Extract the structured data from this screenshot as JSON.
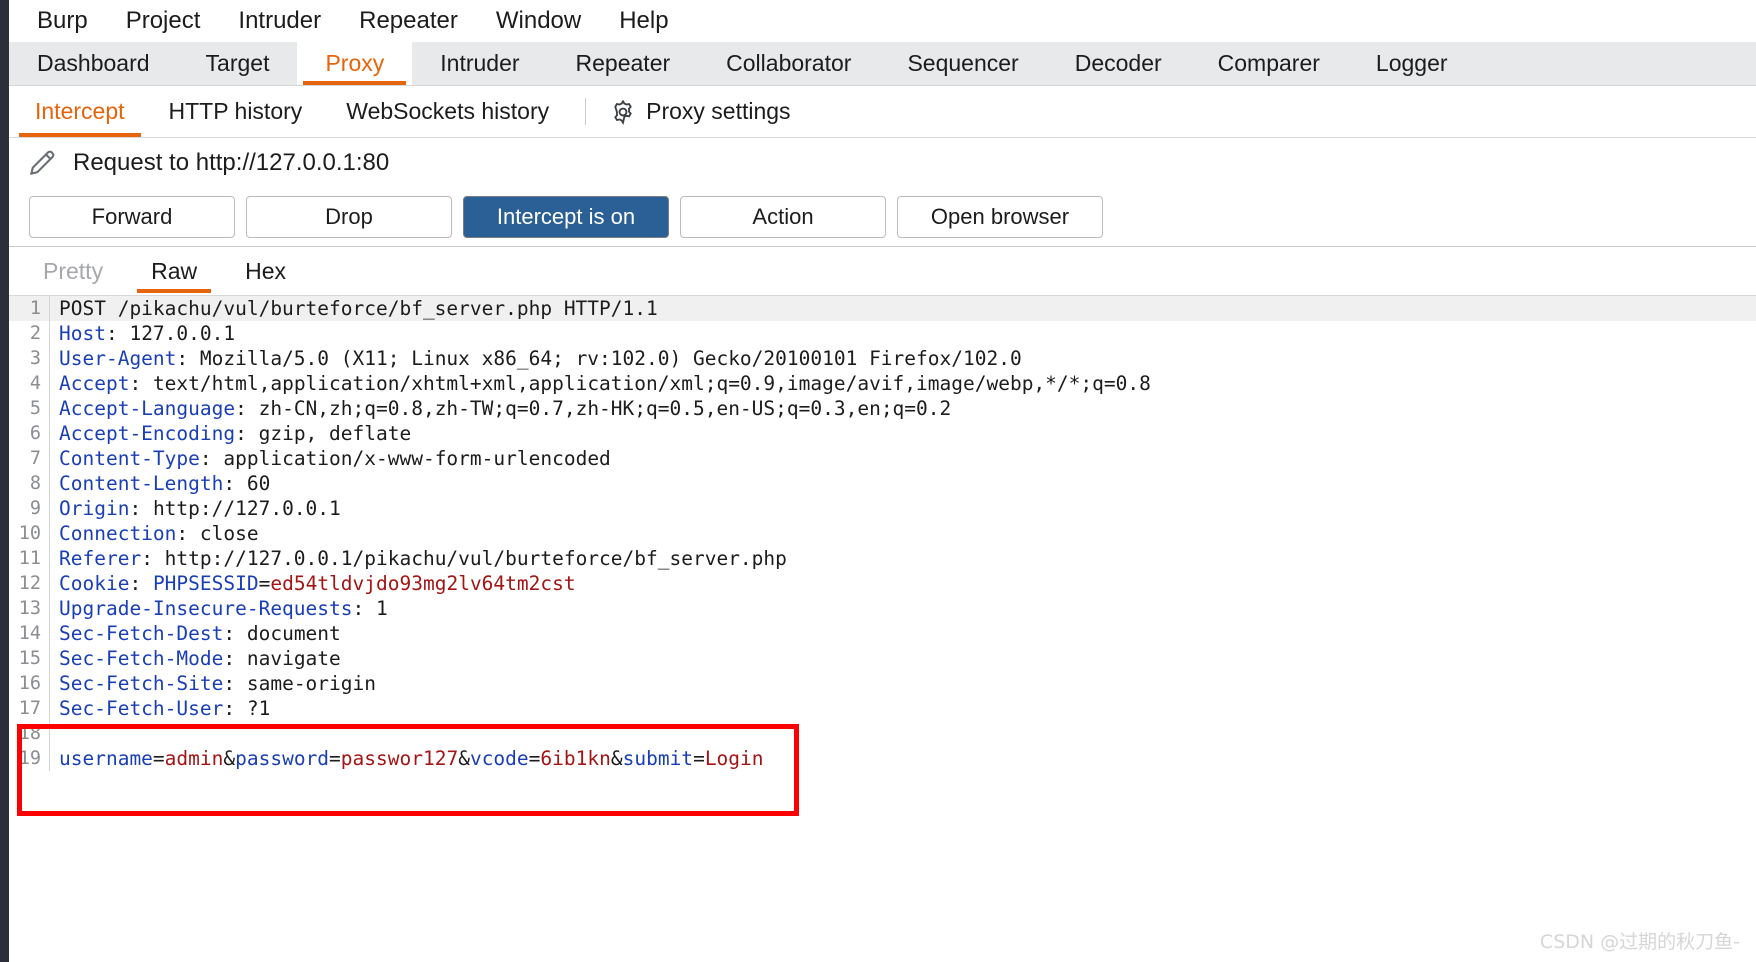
{
  "menubar": {
    "items": [
      {
        "label": "Burp"
      },
      {
        "label": "Project"
      },
      {
        "label": "Intruder"
      },
      {
        "label": "Repeater"
      },
      {
        "label": "Window"
      },
      {
        "label": "Help"
      }
    ]
  },
  "main_tabs": {
    "active": "Proxy",
    "items": [
      {
        "label": "Dashboard"
      },
      {
        "label": "Target"
      },
      {
        "label": "Proxy"
      },
      {
        "label": "Intruder"
      },
      {
        "label": "Repeater"
      },
      {
        "label": "Collaborator"
      },
      {
        "label": "Sequencer"
      },
      {
        "label": "Decoder"
      },
      {
        "label": "Comparer"
      },
      {
        "label": "Logger"
      }
    ]
  },
  "sub_tabs": {
    "active": "Intercept",
    "items": [
      {
        "label": "Intercept"
      },
      {
        "label": "HTTP history"
      },
      {
        "label": "WebSockets history"
      }
    ],
    "settings": {
      "label": "Proxy settings",
      "icon": "gear-icon"
    }
  },
  "request_header": {
    "icon": "pencil-icon",
    "title": "Request to http://127.0.0.1:80"
  },
  "actions": {
    "forward": "Forward",
    "drop": "Drop",
    "intercept_toggle": "Intercept is on",
    "action": "Action",
    "open_browser": "Open browser",
    "intercept_toggle_color": "#2a6095"
  },
  "view_tabs": {
    "active": "Raw",
    "items": [
      {
        "label": "Pretty",
        "state": "disabled"
      },
      {
        "label": "Raw",
        "state": "active"
      },
      {
        "label": "Hex",
        "state": "normal"
      }
    ]
  },
  "editor": {
    "accent_color": "#e8640c",
    "key_color": "#1a3fb5",
    "value_color": "#a31515",
    "lines": [
      {
        "n": "1",
        "type": "request-line",
        "text": "POST /pikachu/vul/burteforce/bf_server.php HTTP/1.1"
      },
      {
        "n": "2",
        "type": "header",
        "key": "Host",
        "value": "127.0.0.1"
      },
      {
        "n": "3",
        "type": "header",
        "key": "User-Agent",
        "value": "Mozilla/5.0 (X11; Linux x86_64; rv:102.0) Gecko/20100101 Firefox/102.0"
      },
      {
        "n": "4",
        "type": "header",
        "key": "Accept",
        "value": "text/html,application/xhtml+xml,application/xml;q=0.9,image/avif,image/webp,*/*;q=0.8"
      },
      {
        "n": "5",
        "type": "header",
        "key": "Accept-Language",
        "value": "zh-CN,zh;q=0.8,zh-TW;q=0.7,zh-HK;q=0.5,en-US;q=0.3,en;q=0.2"
      },
      {
        "n": "6",
        "type": "header",
        "key": "Accept-Encoding",
        "value": "gzip, deflate"
      },
      {
        "n": "7",
        "type": "header",
        "key": "Content-Type",
        "value": "application/x-www-form-urlencoded"
      },
      {
        "n": "8",
        "type": "header",
        "key": "Content-Length",
        "value": "60"
      },
      {
        "n": "9",
        "type": "header",
        "key": "Origin",
        "value": "http://127.0.0.1"
      },
      {
        "n": "10",
        "type": "header",
        "key": "Connection",
        "value": "close"
      },
      {
        "n": "11",
        "type": "header",
        "key": "Referer",
        "value": "http://127.0.0.1/pikachu/vul/burteforce/bf_server.php"
      },
      {
        "n": "12",
        "type": "cookie",
        "key": "Cookie",
        "cookie_name": "PHPSESSID",
        "cookie_value": "ed54tldvjdo93mg2lv64tm2cst"
      },
      {
        "n": "13",
        "type": "header",
        "key": "Upgrade-Insecure-Requests",
        "value": "1"
      },
      {
        "n": "14",
        "type": "header",
        "key": "Sec-Fetch-Dest",
        "value": "document"
      },
      {
        "n": "15",
        "type": "header",
        "key": "Sec-Fetch-Mode",
        "value": "navigate"
      },
      {
        "n": "16",
        "type": "header",
        "key": "Sec-Fetch-Site",
        "value": "same-origin"
      },
      {
        "n": "17",
        "type": "header",
        "key": "Sec-Fetch-User",
        "value": "?1"
      },
      {
        "n": "18",
        "type": "blank",
        "text": ""
      },
      {
        "n": "19",
        "type": "body",
        "params": [
          {
            "key": "username",
            "value": "admin"
          },
          {
            "key": "password",
            "value": "passwor127"
          },
          {
            "key": "vcode",
            "value": "6ib1kn"
          },
          {
            "key": "submit",
            "value": "Login"
          }
        ]
      }
    ]
  },
  "annotation": {
    "box_color": "#ff0000",
    "target_line": "19"
  },
  "watermark": {
    "text": "CSDN @过期的秋刀鱼-"
  }
}
